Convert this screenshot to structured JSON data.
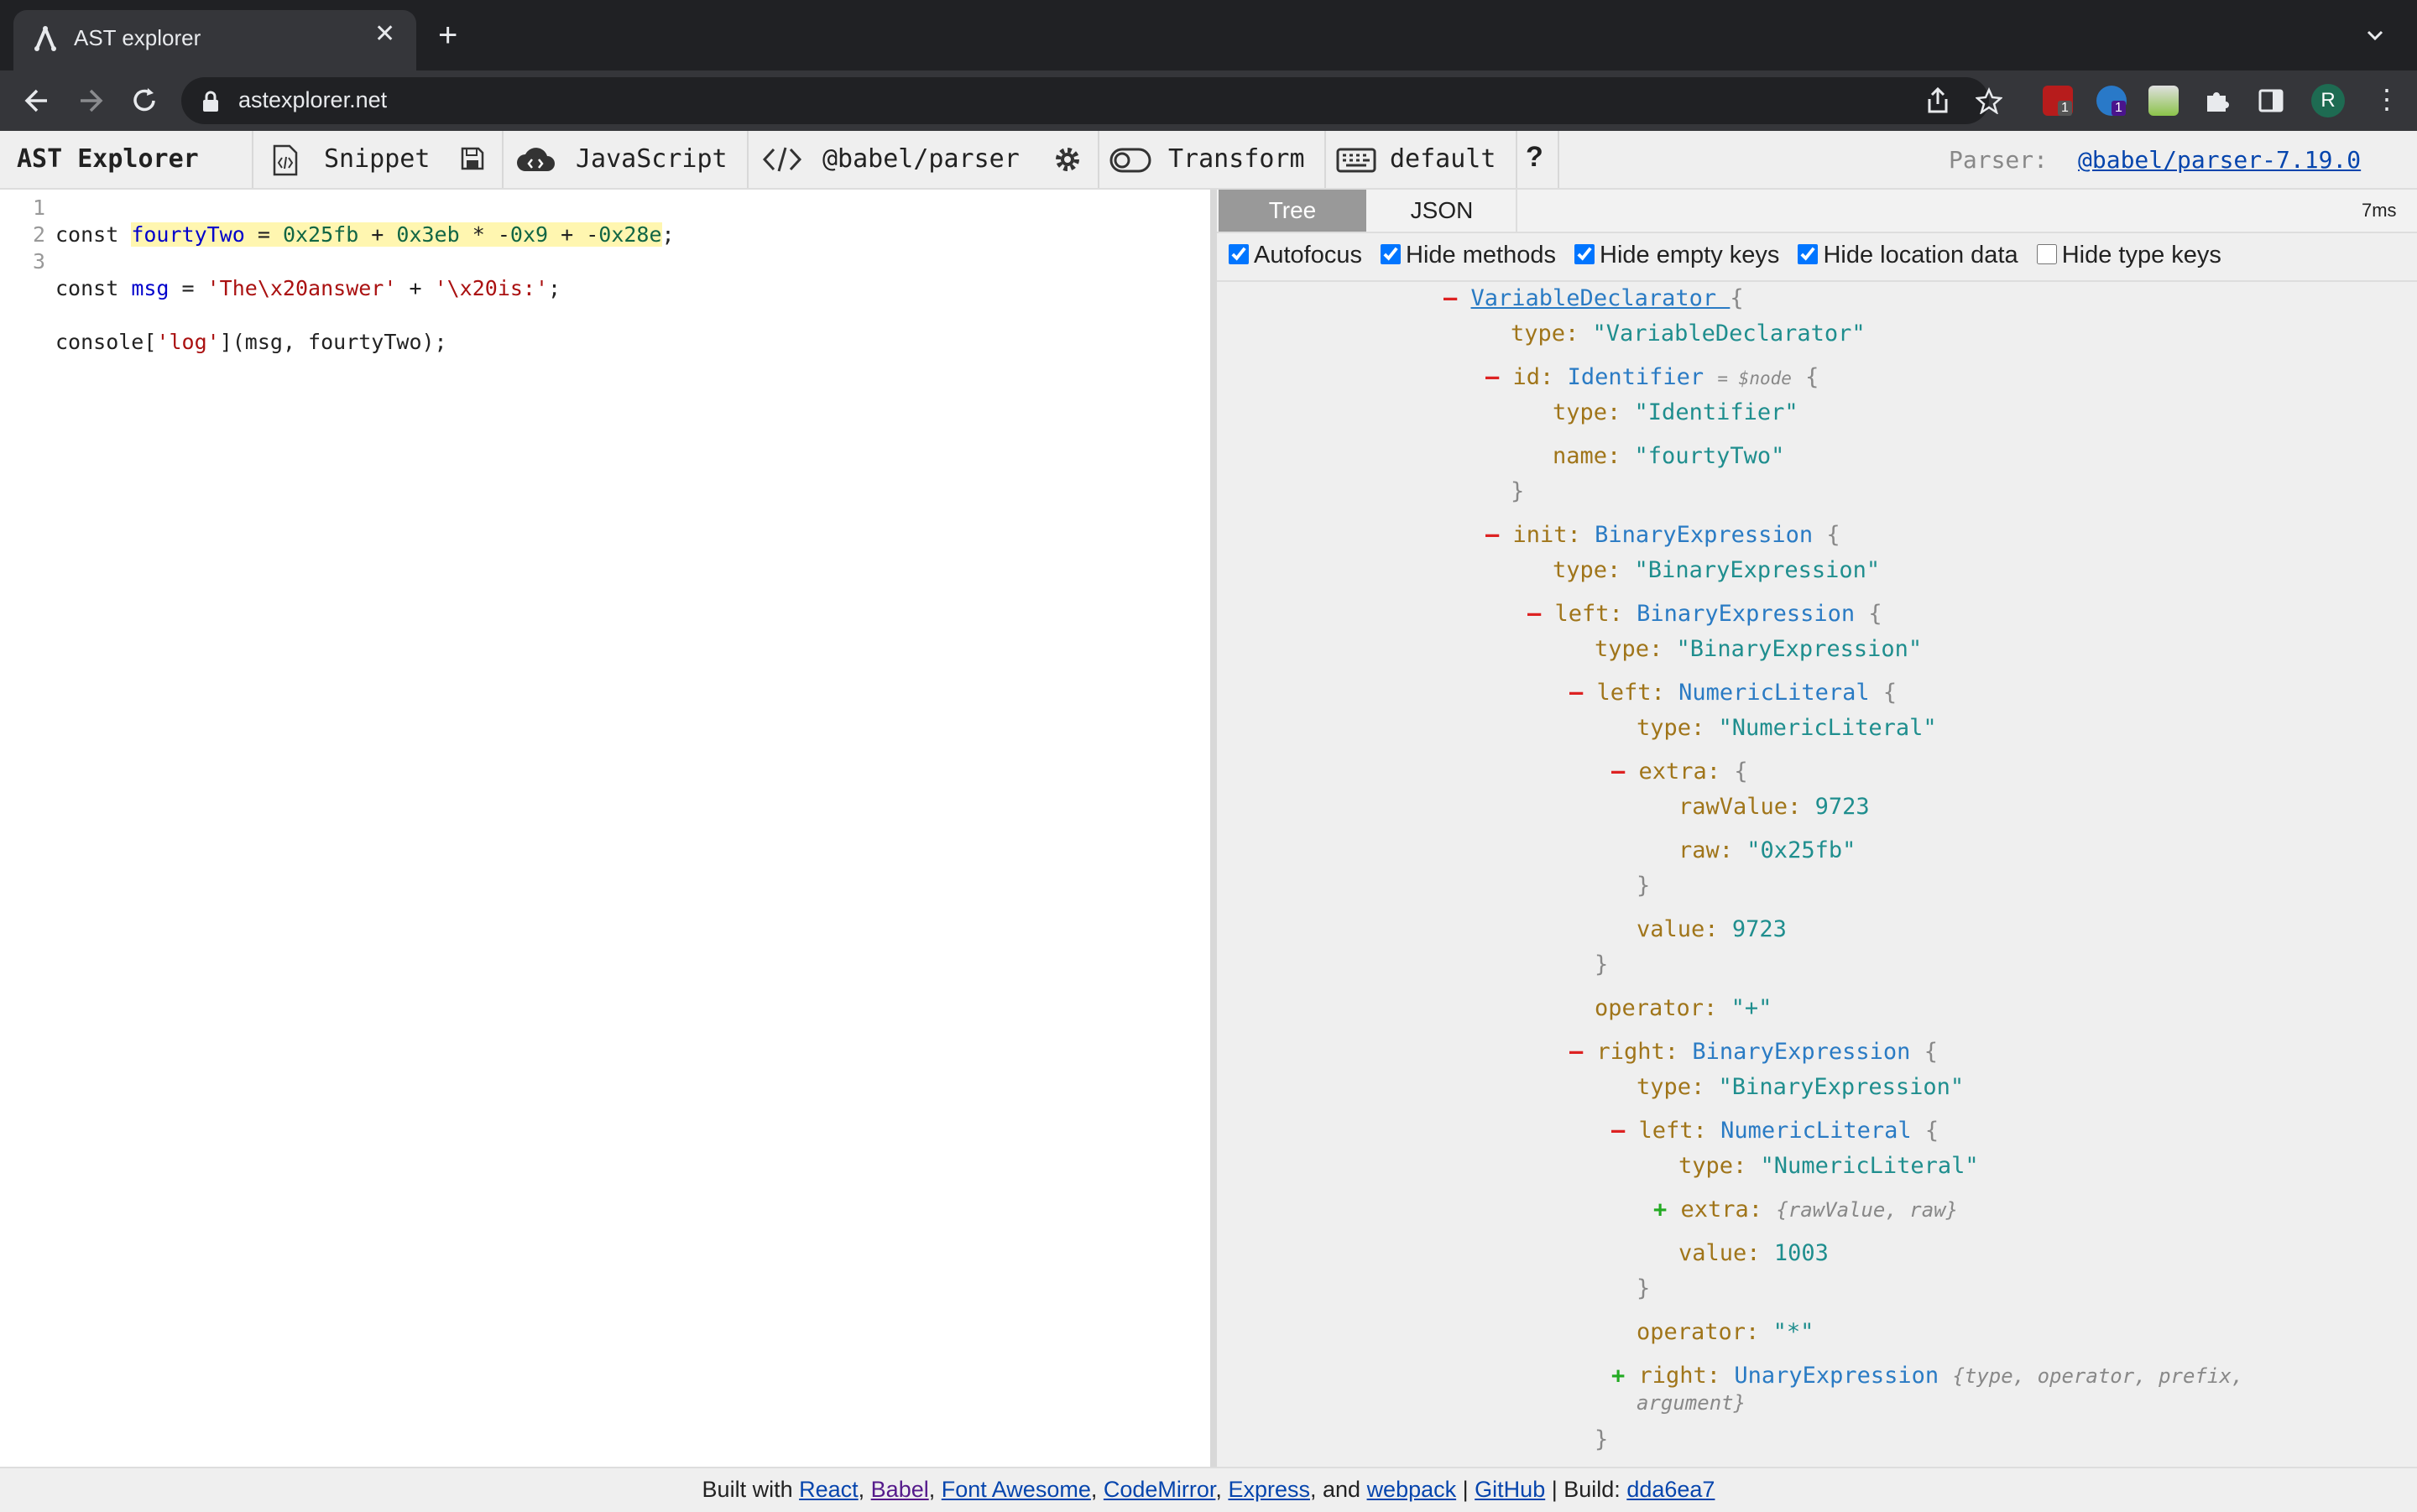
{
  "browser": {
    "tab_title": "AST explorer",
    "url": "astexplorer.net",
    "extension_badges": [
      "1",
      "1"
    ],
    "avatar_letter": "R"
  },
  "app": {
    "logo": "AST Explorer",
    "snippet": "Snippet",
    "language": "JavaScript",
    "parser": "@babel/parser",
    "transform": "Transform",
    "keymap": "default",
    "help": "?",
    "parser_label": "Parser:",
    "parser_version": "@babel/parser-7.19.0"
  },
  "editor": {
    "line_numbers": [
      "1",
      "2",
      "3"
    ]
  },
  "output": {
    "tabs": [
      "Tree",
      "JSON"
    ],
    "timing": "7ms",
    "options": [
      {
        "label": "Autofocus",
        "checked": true
      },
      {
        "label": "Hide methods",
        "checked": true
      },
      {
        "label": "Hide empty keys",
        "checked": true
      },
      {
        "label": "Hide location data",
        "checked": true
      },
      {
        "label": "Hide type keys",
        "checked": false
      }
    ]
  },
  "footer": {
    "built_with": "Built with",
    "react": "React",
    "babel": "Babel",
    "font_awesome": "Font Awesome",
    "codemirror": "CodeMirror",
    "express": "Express",
    "and": ", and",
    "webpack": "webpack",
    "github": "GitHub",
    "build_label": "| Build:",
    "build_hash": "dda6ea7"
  },
  "colors": {
    "tab_bg": "#35363a",
    "appbar_bg": "#efefef",
    "tree_key": "#a0751a",
    "tree_type": "#2a7bc4",
    "tree_value": "#1f8e8e"
  }
}
